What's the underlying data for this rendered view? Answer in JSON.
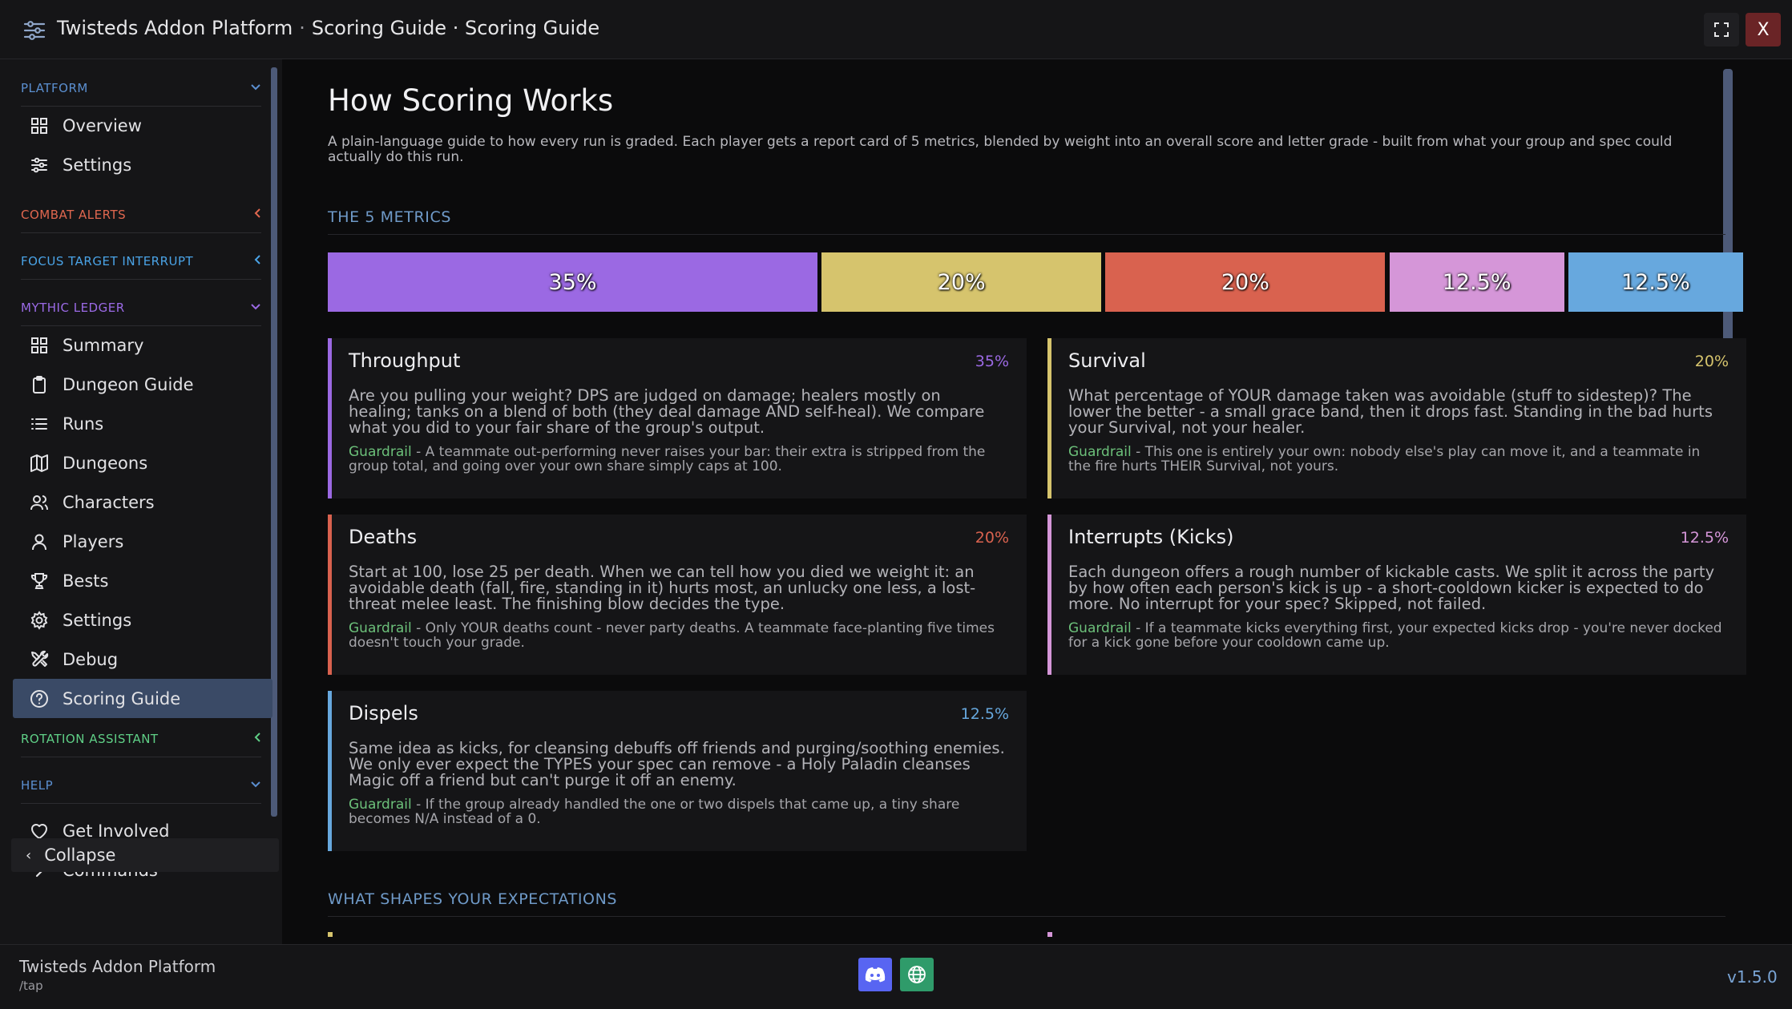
{
  "window": {
    "app_name": "Twisteds Addon Platform",
    "separator": "·",
    "breadcrumb": "Scoring Guide · Scoring Guide",
    "close_label": "X"
  },
  "sidebar": {
    "sections": [
      {
        "label": "PLATFORM",
        "color": "#5b8fd0",
        "expanded": true,
        "items": [
          {
            "label": "Overview",
            "icon": "grid-icon"
          },
          {
            "label": "Settings",
            "icon": "sliders-icon"
          }
        ]
      },
      {
        "label": "COMBAT ALERTS",
        "color": "#e0674f",
        "expanded": false,
        "items": []
      },
      {
        "label": "FOCUS TARGET INTERRUPT",
        "color": "#4aa3e6",
        "expanded": false,
        "items": []
      },
      {
        "label": "MYTHIC LEDGER",
        "color": "#9b6ae6",
        "expanded": true,
        "items": [
          {
            "label": "Summary",
            "icon": "grid-icon"
          },
          {
            "label": "Dungeon Guide",
            "icon": "clipboard-icon"
          },
          {
            "label": "Runs",
            "icon": "list-icon"
          },
          {
            "label": "Dungeons",
            "icon": "map-icon"
          },
          {
            "label": "Characters",
            "icon": "users-icon"
          },
          {
            "label": "Players",
            "icon": "user-icon"
          },
          {
            "label": "Bests",
            "icon": "trophy-icon"
          },
          {
            "label": "Settings",
            "icon": "gear-icon"
          },
          {
            "label": "Debug",
            "icon": "tools-icon"
          },
          {
            "label": "Scoring Guide",
            "icon": "help-circle-icon",
            "active": true
          }
        ]
      },
      {
        "label": "ROTATION ASSISTANT",
        "color": "#5fcf86",
        "expanded": false,
        "items": []
      },
      {
        "label": "HELP",
        "color": "#5b8fd0",
        "expanded": true,
        "items": [
          {
            "label": "Get Involved",
            "icon": "heart-icon"
          },
          {
            "label": "Commands",
            "icon": "chevron-right-icon"
          }
        ]
      }
    ],
    "collapse_label": "Collapse"
  },
  "main": {
    "title": "How Scoring Works",
    "subtitle": "A plain-language guide to how every run is graded. Each player gets a report card of 5 metrics, blended by weight into an overall score and letter grade - built from what your group and spec could actually do this run.",
    "metrics_heading": "THE 5 METRICS",
    "weights_bar": [
      {
        "label": "35%",
        "value": 35,
        "color": "#9b69e3"
      },
      {
        "label": "20%",
        "value": 20,
        "color": "#d6c46d"
      },
      {
        "label": "20%",
        "value": 20,
        "color": "#d9624f"
      },
      {
        "label": "12.5%",
        "value": 12.5,
        "color": "#d596d8"
      },
      {
        "label": "12.5%",
        "value": 12.5,
        "color": "#67a8de"
      }
    ],
    "guardrail_word": "Guardrail",
    "metrics": [
      {
        "name": "Throughput",
        "weight": "35%",
        "color": "#9b69e3",
        "body": "Are you pulling your weight? DPS are judged on damage; healers mostly on healing; tanks on a blend of both (they deal damage AND self-heal). We compare what you did to your fair share of the group's output.",
        "guardrail": " - A teammate out-performing never raises your bar: their extra is stripped from the group total, and going over your own share simply caps at 100."
      },
      {
        "name": "Survival",
        "weight": "20%",
        "color": "#d6c46d",
        "body": "What percentage of YOUR damage taken was avoidable (stuff to sidestep)? The lower the better - a small grace band, then it drops fast. Standing in the bad hurts your Survival, not your healer.",
        "guardrail": " - This one is entirely your own: nobody else's play can move it, and a teammate in the fire hurts THEIR Survival, not yours."
      },
      {
        "name": "Deaths",
        "weight": "20%",
        "color": "#d9624f",
        "body": "Start at 100, lose 25 per death. When we can tell how you died we weight it: an avoidable death (fall, fire, standing in it) hurts most, an unlucky one less, a lost-threat melee least. The finishing blow decides the type.",
        "guardrail": " - Only YOUR deaths count - never party deaths. A teammate face-planting five times doesn't touch your grade."
      },
      {
        "name": "Interrupts (Kicks)",
        "weight": "12.5%",
        "color": "#d596d8",
        "body": "Each dungeon offers a rough number of kickable casts. We split it across the party by how often each person's kick is up - a short-cooldown kicker is expected to do more. No interrupt for your spec? Skipped, not failed.",
        "guardrail": " - If a teammate kicks everything first, your expected kicks drop - you're never docked for a kick gone before your cooldown came up."
      },
      {
        "name": "Dispels",
        "weight": "12.5%",
        "color": "#67a8de",
        "body": "Same idea as kicks, for cleansing debuffs off friends and purging/soothing enemies. We only ever expect the TYPES your spec can remove - a Holy Paladin cleanses Magic off a friend but can't purge it off an enemy.",
        "guardrail": " - If the group already handled the one or two dispels that came up, a tiny share becomes N/A instead of a 0."
      }
    ],
    "expectations_heading": "WHAT SHAPES YOUR EXPECTATIONS"
  },
  "footer": {
    "app_name": "Twisteds Addon Platform",
    "command": "/tap",
    "version": "v1.5.0"
  }
}
